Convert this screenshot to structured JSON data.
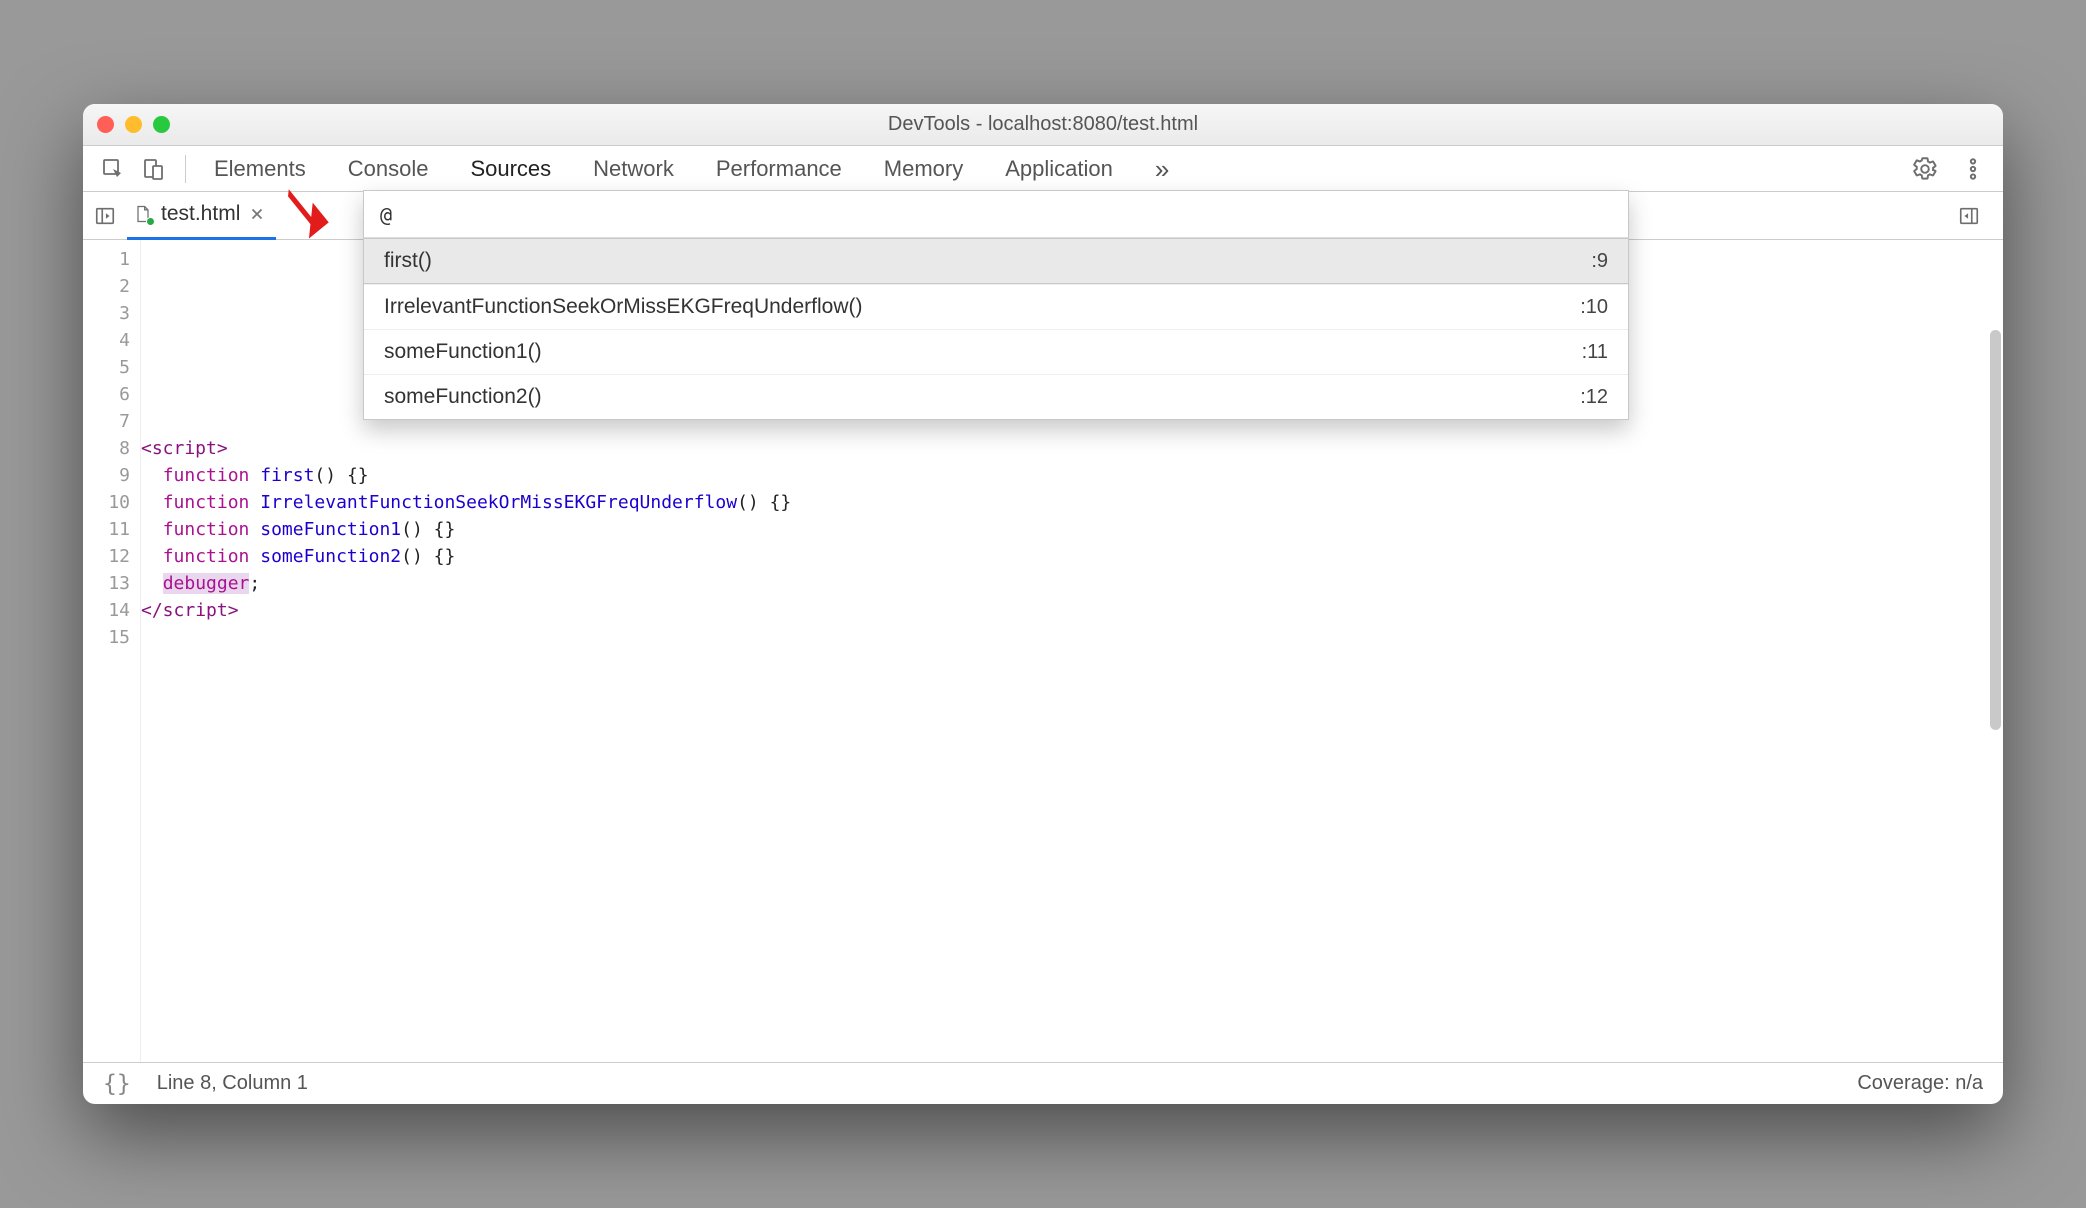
{
  "window": {
    "title": "DevTools - localhost:8080/test.html"
  },
  "panel_tabs": {
    "items": [
      "Elements",
      "Console",
      "Sources",
      "Network",
      "Performance",
      "Memory",
      "Application"
    ],
    "overflow_glyph": "»",
    "active_index": 2
  },
  "file_tab": {
    "name": "test.html"
  },
  "quickopen": {
    "query": "@",
    "items": [
      {
        "name": "first()",
        "line": ":9"
      },
      {
        "name": "IrrelevantFunctionSeekOrMissEKGFreqUnderflow()",
        "line": ":10"
      },
      {
        "name": "someFunction1()",
        "line": ":11"
      },
      {
        "name": "someFunction2()",
        "line": ":12"
      }
    ],
    "selected_index": 0
  },
  "editor": {
    "gutter_start": 1,
    "gutter_end": 15,
    "lines": [
      {
        "indent": 0,
        "tokens": []
      },
      {
        "indent": 0,
        "tokens": []
      },
      {
        "indent": 0,
        "tokens": []
      },
      {
        "indent": 0,
        "tokens": []
      },
      {
        "indent": 0,
        "tokens": []
      },
      {
        "indent": 0,
        "tokens": []
      },
      {
        "indent": 0,
        "tokens": []
      },
      {
        "indent": 0,
        "tokens": [
          {
            "c": "tag",
            "t": "<script>"
          }
        ]
      },
      {
        "indent": 1,
        "tokens": [
          {
            "c": "keyword",
            "t": "function"
          },
          {
            "c": "space",
            "t": " "
          },
          {
            "c": "funcname",
            "t": "first"
          },
          {
            "c": "paren",
            "t": "() "
          },
          {
            "c": "brace",
            "t": "{}"
          }
        ]
      },
      {
        "indent": 1,
        "tokens": [
          {
            "c": "keyword",
            "t": "function"
          },
          {
            "c": "space",
            "t": " "
          },
          {
            "c": "funcname",
            "t": "IrrelevantFunctionSeekOrMissEKGFreqUnderflow"
          },
          {
            "c": "paren",
            "t": "() "
          },
          {
            "c": "brace",
            "t": "{}"
          }
        ]
      },
      {
        "indent": 1,
        "tokens": [
          {
            "c": "keyword",
            "t": "function"
          },
          {
            "c": "space",
            "t": " "
          },
          {
            "c": "funcname",
            "t": "someFunction1"
          },
          {
            "c": "paren",
            "t": "() "
          },
          {
            "c": "brace",
            "t": "{}"
          }
        ]
      },
      {
        "indent": 1,
        "tokens": [
          {
            "c": "keyword",
            "t": "function"
          },
          {
            "c": "space",
            "t": " "
          },
          {
            "c": "funcname",
            "t": "someFunction2"
          },
          {
            "c": "paren",
            "t": "() "
          },
          {
            "c": "brace",
            "t": "{}"
          }
        ]
      },
      {
        "indent": 1,
        "tokens": [
          {
            "c": "debugger",
            "t": "debugger"
          },
          {
            "c": "paren",
            "t": ";"
          }
        ]
      },
      {
        "indent": 0,
        "tokens": [
          {
            "c": "tag",
            "t": "</scr"
          },
          {
            "c": "tag",
            "t": "ipt>"
          }
        ]
      },
      {
        "indent": 0,
        "tokens": []
      }
    ]
  },
  "statusbar": {
    "braces": "{}",
    "position": "Line 8, Column 1",
    "coverage": "Coverage: n/a"
  }
}
